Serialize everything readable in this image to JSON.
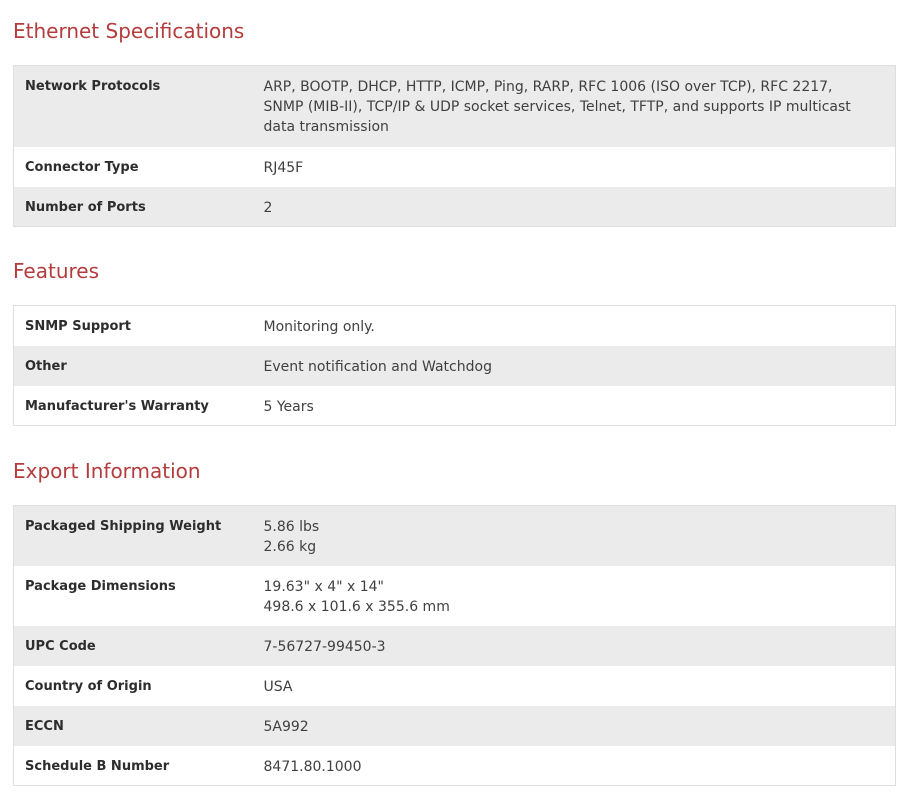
{
  "sections": [
    {
      "title": "Ethernet Specifications",
      "rows": [
        {
          "label": "Network Protocols",
          "value": [
            "ARP, BOOTP, DHCP, HTTP, ICMP, Ping, RARP, RFC 1006 (ISO over TCP), RFC 2217, SNMP (MIB-II), TCP/IP & UDP socket services, Telnet, TFTP, and supports IP multicast data transmission"
          ]
        },
        {
          "label": "Connector Type",
          "value": [
            "RJ45F"
          ]
        },
        {
          "label": "Number of Ports",
          "value": [
            "2"
          ]
        }
      ]
    },
    {
      "title": "Features",
      "rows": [
        {
          "label": "SNMP Support",
          "value": [
            "Monitoring only."
          ]
        },
        {
          "label": "Other",
          "value": [
            "Event notification and Watchdog"
          ]
        },
        {
          "label": "Manufacturer's Warranty",
          "value": [
            "5 Years"
          ]
        }
      ]
    },
    {
      "title": "Export Information",
      "rows": [
        {
          "label": "Packaged Shipping Weight",
          "value": [
            "5.86 lbs",
            "2.66 kg"
          ]
        },
        {
          "label": "Package Dimensions",
          "value": [
            "19.63\" x 4\" x 14\"",
            "498.6 x 101.6 x 355.6 mm"
          ]
        },
        {
          "label": "UPC Code",
          "value": [
            "7-56727-99450-3"
          ]
        },
        {
          "label": "Country of Origin",
          "value": [
            "USA"
          ]
        },
        {
          "label": "ECCN",
          "value": [
            "5A992"
          ]
        },
        {
          "label": "Schedule B Number",
          "value": [
            "8471.80.1000"
          ]
        }
      ]
    }
  ]
}
